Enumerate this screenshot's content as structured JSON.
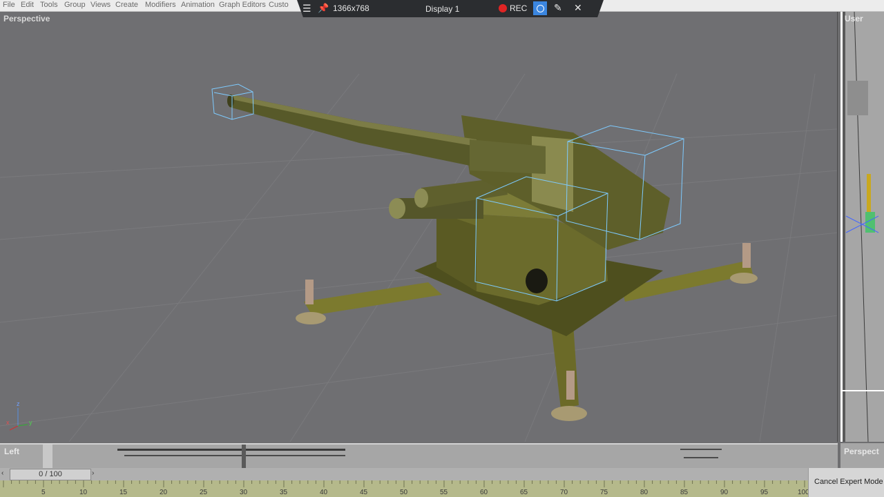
{
  "menu": [
    "File",
    "Edit",
    "Tools",
    "Group",
    "Views",
    "Create",
    "Modifiers",
    "Animation",
    "Graph Editors",
    "Custo"
  ],
  "recorder": {
    "resolution": "1366x768",
    "display": "Display 1",
    "rec_label": "REC"
  },
  "viewports": {
    "main": "Perspective",
    "top_right": "User",
    "left": "Left",
    "bottom_right": "Perspect"
  },
  "timeline": {
    "frame_counter": "0 / 100",
    "ticks": [
      "5",
      "10",
      "15",
      "20",
      "25",
      "30",
      "35",
      "40",
      "45",
      "50",
      "55",
      "60",
      "65",
      "70",
      "75",
      "80",
      "85",
      "90",
      "95",
      "100"
    ]
  },
  "expert_mode_button": "Cancel Expert Mode",
  "axis_labels": {
    "x": "x",
    "y": "y",
    "z": "z"
  },
  "colors": {
    "menu_bg": "#ececec",
    "toolbar_bg": "#2b2d30",
    "viewport_bg": "#6f6f72",
    "accent_blue": "#3b86e0",
    "rec_red": "#e02424",
    "selection_box": "#7ecbff",
    "gun_green": "#6b6b2c"
  }
}
